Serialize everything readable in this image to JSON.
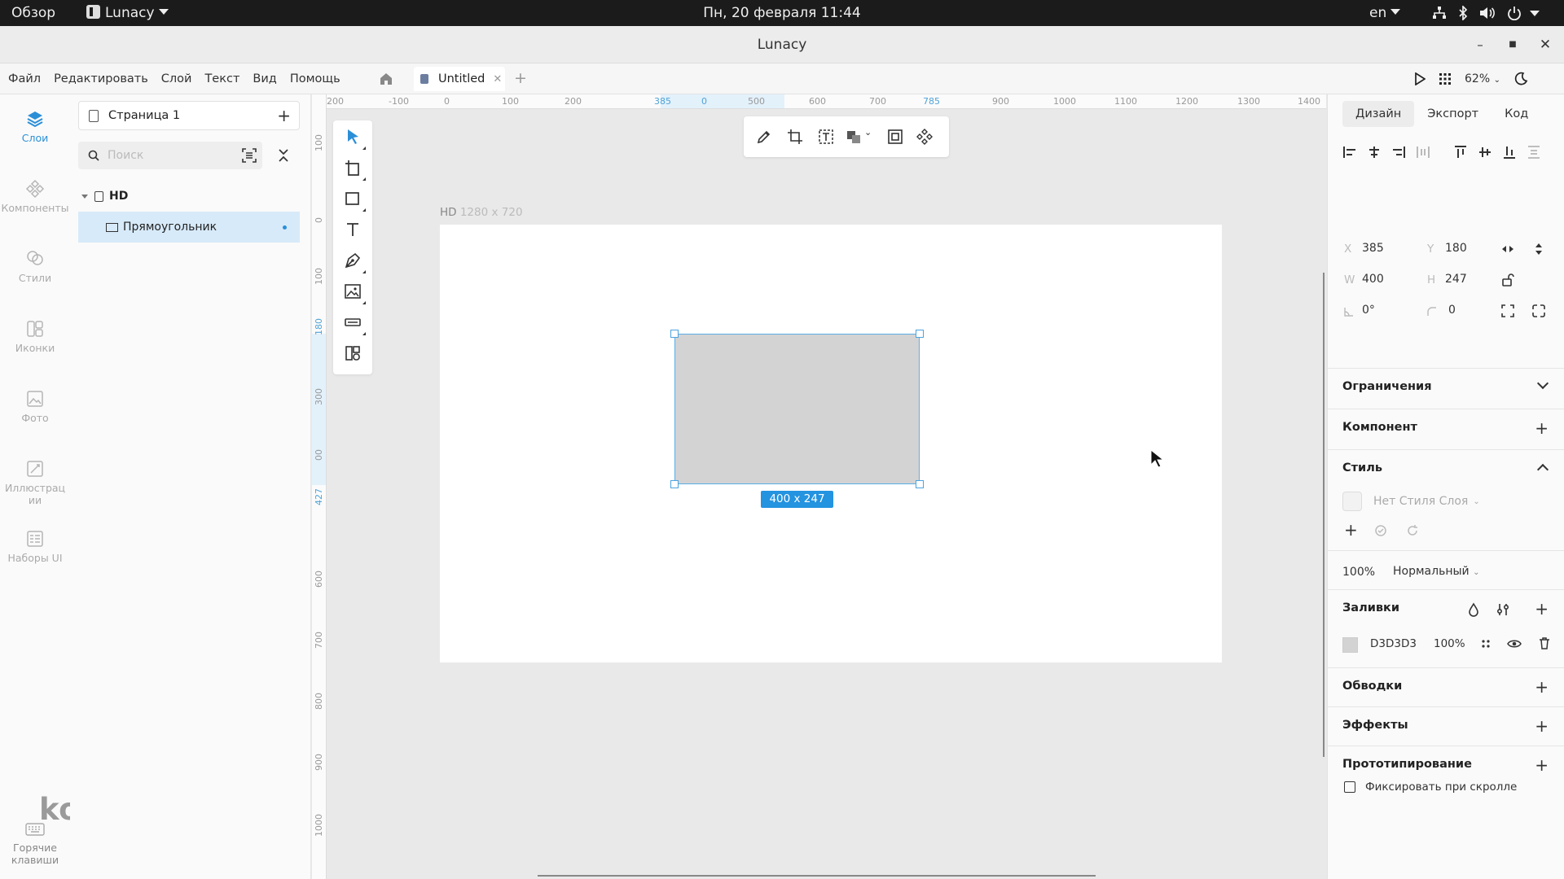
{
  "system_bar": {
    "overview": "Обзор",
    "app_name": "Lunacy",
    "clock": "Пн, 20 февраля  11:44",
    "lang": "en"
  },
  "window": {
    "title": "Lunacy"
  },
  "menu": {
    "items": [
      "Файл",
      "Редактировать",
      "Слой",
      "Текст",
      "Вид",
      "Помощь"
    ],
    "tab_label": "Untitled",
    "zoom": "62%"
  },
  "leftnav": {
    "items": [
      {
        "label": "Слои",
        "icon": "layers-icon",
        "active": true
      },
      {
        "label": "Компоненты",
        "icon": "components-icon"
      },
      {
        "label": "Стили",
        "icon": "styles-icon"
      },
      {
        "label": "Иконки",
        "icon": "icons-icon"
      },
      {
        "label": "Фото",
        "icon": "photo-icon"
      },
      {
        "label": "Иллюстрации",
        "icon": "illustrations-icon"
      },
      {
        "label": "Наборы UI",
        "icon": "ui-kits-icon"
      }
    ],
    "hotkeys_label": "Горячие клавиши",
    "watermark": "kodprog.ru"
  },
  "layers": {
    "page_name": "Страница 1",
    "search_placeholder": "Поиск",
    "artboard_name": "HD",
    "layer_name": "Прямоугольник"
  },
  "rulers": {
    "h": [
      "200",
      "100",
      "0",
      "100",
      "200",
      "385",
      "0",
      "500",
      "600",
      "700",
      "785",
      "900",
      "1000",
      "1100",
      "1200",
      "1300",
      "1400"
    ],
    "v": [
      "100",
      "0",
      "100",
      "180",
      "300",
      "00",
      "427",
      "600",
      "700",
      "800",
      "900",
      "1000"
    ]
  },
  "canvas": {
    "artboard_label": "HD",
    "artboard_size": "1280 x 720",
    "selection_size": "400 x 247"
  },
  "design": {
    "tabs": [
      "Дизайн",
      "Экспорт",
      "Код"
    ],
    "x_label": "X",
    "x": "385",
    "y_label": "Y",
    "y": "180",
    "w_label": "W",
    "w": "400",
    "h_label": "H",
    "h": "247",
    "rotation": "0°",
    "radius": "0",
    "constraints": "Ограничения",
    "component": "Компонент",
    "style": "Стиль",
    "layer_style": "Нет Стиля Слоя",
    "opacity": "100%",
    "blend": "Нормальный",
    "fills": "Заливки",
    "fill_hex": "D3D3D3",
    "fill_opacity": "100%",
    "fill_color": "#d3d3d3",
    "borders": "Обводки",
    "effects": "Эффекты",
    "prototyping": "Прототипирование",
    "fix_on_scroll": "Фиксировать при скролле"
  }
}
